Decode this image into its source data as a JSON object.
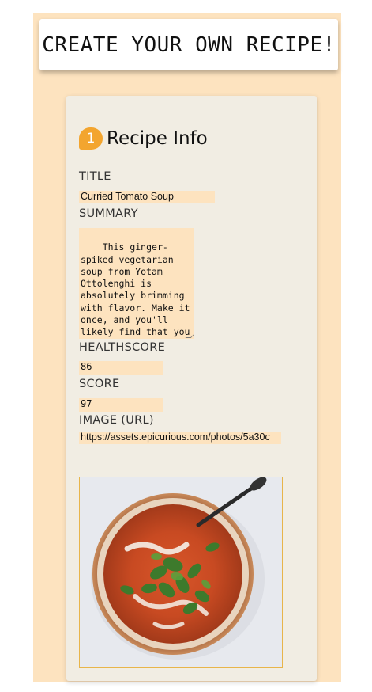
{
  "header": {
    "title": "CREATE YOUR OWN RECIPE!"
  },
  "recipe_info": {
    "step_number": "1",
    "section_title": "Recipe Info",
    "title_label": "TITLE",
    "title_value": "Curried Tomato Soup",
    "summary_label": "SUMMARY",
    "summary_value": "This ginger-spiked vegetarian soup from Yotam Ottolenghi is absolutely brimming with flavor. Make it once, and you'll likely find that you want to add it",
    "healthscore_label": "HEALTHSCORE",
    "healthscore_value": "86",
    "score_label": "SCORE",
    "score_value": "97",
    "image_label": "IMAGE (URL)",
    "image_value": "https://assets.epicurious.com/photos/5a30c"
  },
  "colors": {
    "page_background": "#fde3bf",
    "card_background": "#f1ede3",
    "accent": "#f3a52f",
    "input_background": "#fde3bf"
  },
  "icons": {
    "step_badge": "number-badge-icon",
    "image": "curried-tomato-soup-photo"
  }
}
